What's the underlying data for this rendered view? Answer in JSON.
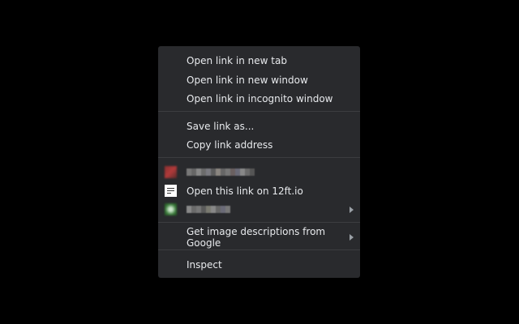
{
  "menu": {
    "items": {
      "new_tab": "Open link in new tab",
      "new_window": "Open link in new window",
      "incognito": "Open link in incognito window",
      "save_as": "Save link as...",
      "copy_address": "Copy link address",
      "open_12ft": "Open this link on 12ft.io",
      "image_descriptions": "Get image descriptions from Google",
      "inspect": "Inspect"
    }
  },
  "colors": {
    "background": "#292a2d",
    "text": "#e8eaed",
    "separator": "#3c3d40"
  }
}
